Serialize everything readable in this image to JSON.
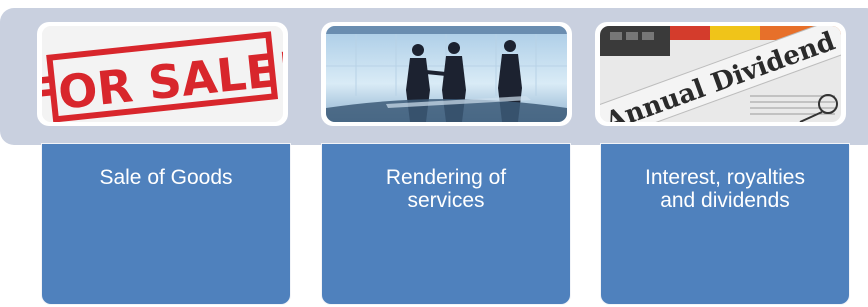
{
  "colors": {
    "band": "#c9d0df",
    "card": "#4f81bd",
    "text": "#ffffff"
  },
  "items": [
    {
      "image": {
        "sign_text": "FOR SALE!"
      },
      "label_lines": [
        "Sale of Goods"
      ]
    },
    {
      "image": {
        "scene": "business-handshake"
      },
      "label_lines": [
        "Rendering of",
        "services"
      ]
    },
    {
      "image": {
        "headline": "Annual Dividend"
      },
      "label_lines": [
        "Interest, royalties",
        "and dividends"
      ]
    }
  ]
}
